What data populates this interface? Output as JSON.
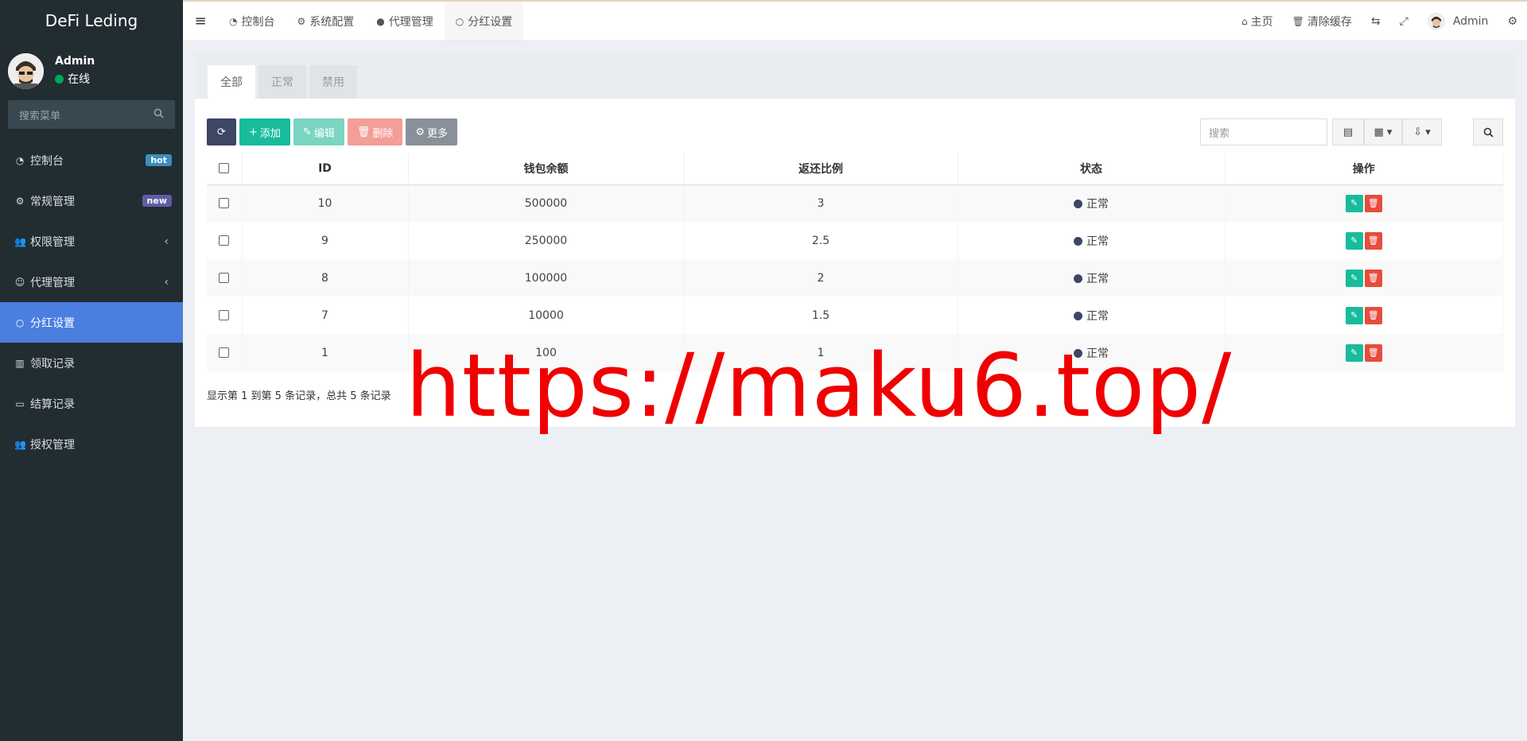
{
  "brand": "DeFi Leding",
  "user": {
    "name": "Admin",
    "status": "在线"
  },
  "menu_search_placeholder": "搜索菜单",
  "menu": [
    {
      "label": "控制台",
      "icon": "dashboard-icon",
      "badge": "hot"
    },
    {
      "label": "常规管理",
      "icon": "cogs-icon",
      "badge": "new"
    },
    {
      "label": "权限管理",
      "icon": "group-icon",
      "chevron": "‹"
    },
    {
      "label": "代理管理",
      "icon": "user-circle-icon",
      "chevron": "‹"
    },
    {
      "label": "分红设置",
      "icon": "circle-icon",
      "active": true
    },
    {
      "label": "领取记录",
      "icon": "bank-icon"
    },
    {
      "label": "结算记录",
      "icon": "card-icon"
    },
    {
      "label": "授权管理",
      "icon": "group-icon"
    }
  ],
  "topnav": {
    "tabs": [
      "控制台",
      "系统配置",
      "代理管理",
      "分红设置"
    ],
    "home": "主页",
    "clear_cache": "清除缓存",
    "admin": "Admin"
  },
  "panel": {
    "tabs": [
      "全部",
      "正常",
      "禁用"
    ],
    "toolbar": {
      "add": "添加",
      "edit": "编辑",
      "delete": "删除",
      "more": "更多"
    },
    "search_placeholder": "搜索",
    "columns": [
      "ID",
      "钱包余额",
      "返还比例",
      "状态",
      "操作"
    ],
    "rows": [
      {
        "id": "10",
        "balance": "500000",
        "ratio": "3",
        "status": "正常"
      },
      {
        "id": "9",
        "balance": "250000",
        "ratio": "2.5",
        "status": "正常"
      },
      {
        "id": "8",
        "balance": "100000",
        "ratio": "2",
        "status": "正常"
      },
      {
        "id": "7",
        "balance": "10000",
        "ratio": "1.5",
        "status": "正常"
      },
      {
        "id": "1",
        "balance": "100",
        "ratio": "1",
        "status": "正常"
      }
    ],
    "pager_info": "显示第 1 到第 5 条记录，总共 5 条记录"
  },
  "watermark": "https://maku6.top/",
  "colors": {
    "sidebar": "#222d32",
    "active": "#4a7fe0",
    "add": "#18bc9c",
    "delete": "#e74c3c",
    "refresh": "#3d4663"
  }
}
